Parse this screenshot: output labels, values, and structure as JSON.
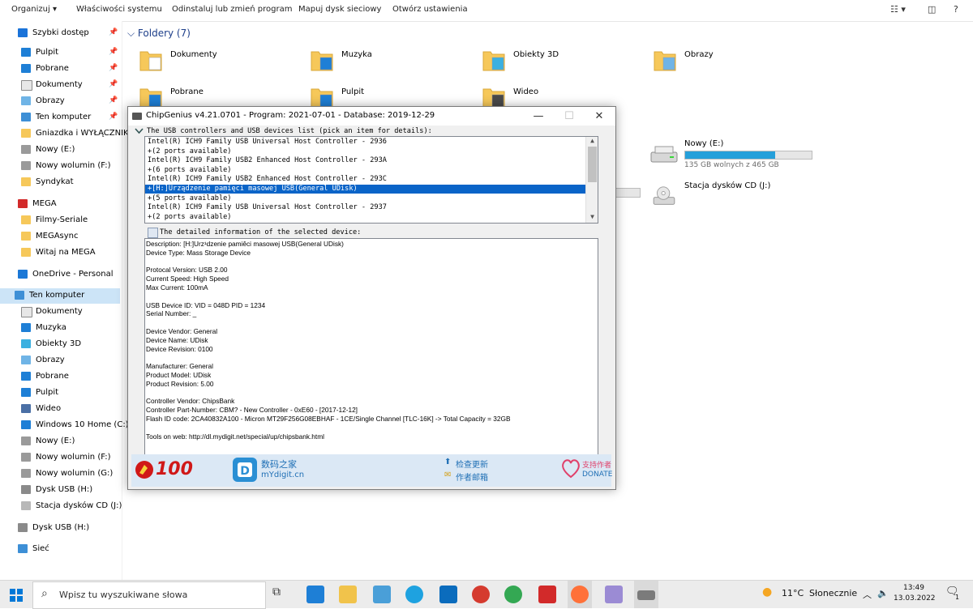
{
  "ribbon": {
    "organize": "Organizuj",
    "system_properties": "Właściwości systemu",
    "uninstall": "Odinstaluj lub zmień program",
    "map_drive": "Mapuj dysk sieciowy",
    "open_settings": "Otwórz ustawienia"
  },
  "sidebar": {
    "items": [
      {
        "label": "Szybki dostęp",
        "icon": "star-icon"
      },
      {
        "label": "Pulpit",
        "icon": "desktop-icon"
      },
      {
        "label": "Pobrane",
        "icon": "download-icon"
      },
      {
        "label": "Dokumenty",
        "icon": "document-icon"
      },
      {
        "label": "Obrazy",
        "icon": "pictures-icon"
      },
      {
        "label": "Ten komputer",
        "icon": "computer-icon"
      },
      {
        "label": "Gniazdka i WYŁĄCZNIK",
        "icon": "folder-icon"
      },
      {
        "label": "Nowy (E:)",
        "icon": "drive-icon"
      },
      {
        "label": "Nowy wolumin (F:)",
        "icon": "drive-icon"
      },
      {
        "label": "Syndykat",
        "icon": "folder-icon"
      },
      {
        "label": "MEGA",
        "icon": "mega-icon"
      },
      {
        "label": "Filmy-Seriale",
        "icon": "folder-icon"
      },
      {
        "label": "MEGAsync",
        "icon": "folder-icon"
      },
      {
        "label": "Witaj na MEGA",
        "icon": "folder-icon"
      },
      {
        "label": "OneDrive - Personal",
        "icon": "cloud-icon"
      },
      {
        "label": "Ten komputer",
        "icon": "computer-icon"
      },
      {
        "label": "Dokumenty",
        "icon": "document-icon"
      },
      {
        "label": "Muzyka",
        "icon": "music-icon"
      },
      {
        "label": "Obiekty 3D",
        "icon": "cube-icon"
      },
      {
        "label": "Obrazy",
        "icon": "pictures-icon"
      },
      {
        "label": "Pobrane",
        "icon": "download-icon"
      },
      {
        "label": "Pulpit",
        "icon": "desktop-icon"
      },
      {
        "label": "Wideo",
        "icon": "video-icon"
      },
      {
        "label": "Windows 10 Home (C:)",
        "icon": "windows-drive-icon"
      },
      {
        "label": "Nowy (E:)",
        "icon": "drive-icon"
      },
      {
        "label": "Nowy wolumin (F:)",
        "icon": "drive-icon"
      },
      {
        "label": "Nowy wolumin (G:)",
        "icon": "drive-icon"
      },
      {
        "label": "Dysk USB (H:)",
        "icon": "usb-drive-icon"
      },
      {
        "label": "Stacja dysków CD (J:)",
        "icon": "cd-drive-icon"
      },
      {
        "label": "Dysk USB (H:)",
        "icon": "usb-drive-icon"
      },
      {
        "label": "Sieć",
        "icon": "network-icon"
      }
    ]
  },
  "content": {
    "folders_header": "Foldery (7)",
    "folders": [
      "Dokumenty",
      "Muzyka",
      "Obiekty 3D",
      "Obrazy",
      "Pobrane",
      "Pulpit",
      "Wideo"
    ],
    "drives": [
      {
        "name": "Nowy (E:)",
        "free": "135 GB wolnych z 465 GB",
        "used_fraction": 0.71
      },
      {
        "name": "Stacja dysków CD (J:)"
      }
    ]
  },
  "chipgenius": {
    "title": "ChipGenius v4.21.0701 - Program: 2021-07-01 - Database: 2019-12-29",
    "minimize": "—",
    "maximize": "☐",
    "close": "✕",
    "list_header": "The USB controllers and USB devices list (pick an item for details):",
    "list_rows": [
      "Intel(R) ICH9 Family USB Universal Host Controller - 2936",
      "+(2 ports available)",
      "Intel(R) ICH9 Family USB2 Enhanced Host Controller - 293A",
      "+(6 ports available)",
      "Intel(R) ICH9 Family USB2 Enhanced Host Controller - 293C",
      "+[H:]Urządzenie pamięci masowej USB(General UDisk)",
      "+(5 ports available)",
      "Intel(R) ICH9 Family USB Universal Host Controller - 2937",
      "+(2 ports available)"
    ],
    "selected_row": 5,
    "detail_header": "The detailed information of the selected device:",
    "details": [
      "Description: [H:]Urz¹dzenie pamiêci masowej USB(General UDisk)",
      "Device Type:     Mass Storage Device",
      "",
      "Protocal Version: USB 2.00",
      "Current Speed: High Speed",
      "Max Current: 100mA",
      "",
      "USB Device ID: VID = 048D PID = 1234",
      "Serial Number: _",
      "",
      "Device Vendor: General",
      "Device Name: UDisk",
      "Device Revision: 0100",
      "",
      "Manufacturer: General",
      "Product Model: UDisk",
      "Product Revision: 5.00",
      "",
      "Controller Vendor: ChipsBank",
      "Controller Part-Number: CBM? - New Controller - 0xE60 - [2017-12-12]",
      "Flash ID code:    2CA40832A100 - Micron MT29F256G08EBHAF - 1CE/Single Channel [TLC-16K] -> Total Capacity = 32GB",
      "",
      "Tools on web:     http://dl.mydigit.net/special/up/chipsbank.html"
    ],
    "footer": {
      "logo_number": "100",
      "site_cn": "数码之家",
      "site_url": "mYdigit.cn",
      "check_update": "检查更新",
      "author_mail": "作者邮箱",
      "support_author": "支持作者",
      "donate": "DONATE"
    }
  },
  "taskbar": {
    "search_placeholder": "Wpisz tu wyszukiwane słowa",
    "weather_temp": "11°C",
    "weather_desc": "Słonecznie",
    "time": "13:49",
    "date": "13.03.2022",
    "notification_count": "1"
  },
  "colors": {
    "accent": "#0a64c8",
    "selection": "#cce4f7",
    "drive_bar": "#26a0da",
    "folder_yellow": "#f6c85a",
    "title_blue": "#1e3f8a"
  }
}
